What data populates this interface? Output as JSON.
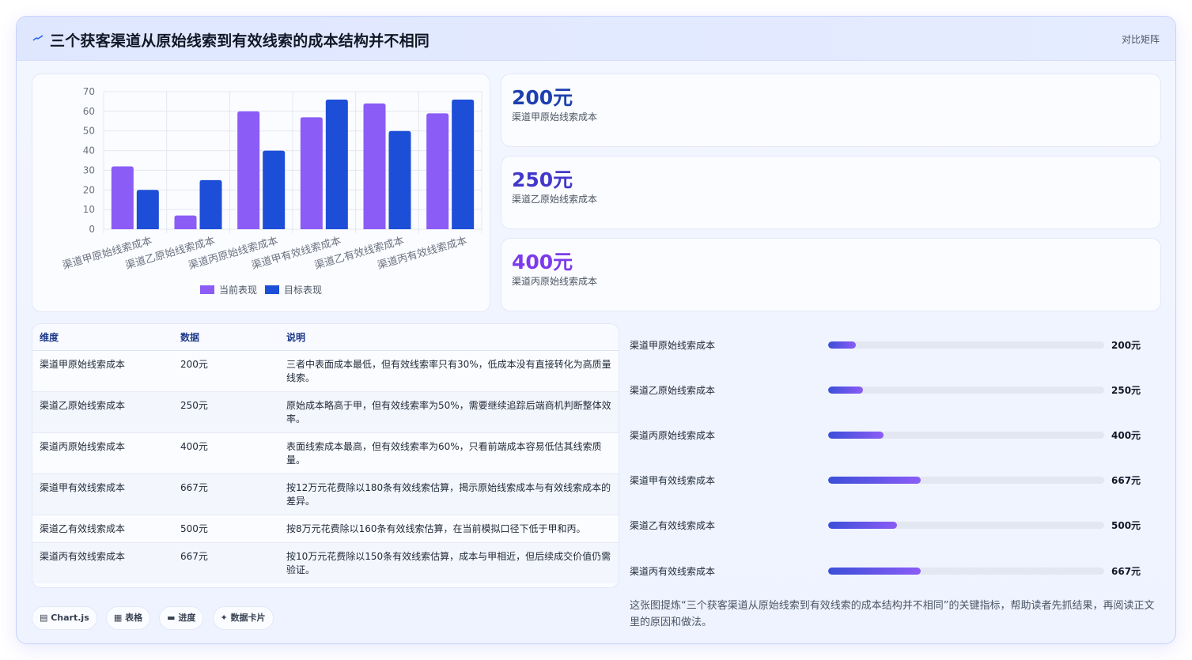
{
  "header": {
    "title": "三个获客渠道从原始线索到有效线索的成本结构并不相同",
    "link": "对比矩阵"
  },
  "chart_data": {
    "type": "bar",
    "categories": [
      "渠道甲原始线索成本",
      "渠道乙原始线索成本",
      "渠道丙原始线索成本",
      "渠道甲有效线索成本",
      "渠道乙有效线索成本",
      "渠道丙有效线索成本"
    ],
    "series": [
      {
        "name": "当前表现",
        "values": [
          32,
          7,
          60,
          57,
          64,
          59
        ],
        "color": "#8b5cf6"
      },
      {
        "name": "目标表现",
        "values": [
          20,
          25,
          40,
          66,
          50,
          66
        ],
        "color": "#1d4ed8"
      }
    ],
    "y_ticks": [
      "0",
      "10",
      "20",
      "30",
      "40",
      "50",
      "60",
      "70"
    ],
    "ylim": [
      0,
      70
    ],
    "grid": true,
    "legend_position": "bottom"
  },
  "kpis": [
    {
      "value": "200元",
      "label": "渠道甲原始线索成本",
      "color": "#1e40af"
    },
    {
      "value": "250元",
      "label": "渠道乙原始线索成本",
      "color": "#4338ca"
    },
    {
      "value": "400元",
      "label": "渠道丙原始线索成本",
      "color": "#7c3aed"
    }
  ],
  "table": {
    "headers": [
      "维度",
      "数据",
      "说明"
    ],
    "rows": [
      [
        "渠道甲原始线索成本",
        "200元",
        "三者中表面成本最低，但有效线索率只有30%，低成本没有直接转化为高质量线索。"
      ],
      [
        "渠道乙原始线索成本",
        "250元",
        "原始成本略高于甲，但有效线索率为50%，需要继续追踪后端商机判断整体效率。"
      ],
      [
        "渠道丙原始线索成本",
        "400元",
        "表面线索成本最高，但有效线索率为60%，只看前端成本容易低估其线索质量。"
      ],
      [
        "渠道甲有效线索成本",
        "667元",
        "按12万元花费除以180条有效线索估算，揭示原始线索成本与有效线索成本的差异。"
      ],
      [
        "渠道乙有效线索成本",
        "500元",
        "按8万元花费除以160条有效线索估算，在当前模拟口径下低于甲和丙。"
      ],
      [
        "渠道丙有效线索成本",
        "667元",
        "按10万元花费除以150条有效线索估算，成本与甲相近，但后续成交价值仍需验证。"
      ]
    ]
  },
  "progress": [
    {
      "label": "渠道甲原始线索成本",
      "value": "200元",
      "fraction": 0.1
    },
    {
      "label": "渠道乙原始线索成本",
      "value": "250元",
      "fraction": 0.125
    },
    {
      "label": "渠道丙原始线索成本",
      "value": "400元",
      "fraction": 0.2
    },
    {
      "label": "渠道甲有效线索成本",
      "value": "667元",
      "fraction": 0.335
    },
    {
      "label": "渠道乙有效线索成本",
      "value": "500元",
      "fraction": 0.25
    },
    {
      "label": "渠道丙有效线索成本",
      "value": "667元",
      "fraction": 0.335
    }
  ],
  "note": "这张图提炼“三个获客渠道从原始线索到有效线索的成本结构并不相同”的关键指标，帮助读者先抓结果，再阅读正文里的原因和做法。",
  "chips": [
    {
      "icon": "chart-icon",
      "label": "Chart.js"
    },
    {
      "icon": "table-icon",
      "label": "表格"
    },
    {
      "icon": "progress-icon",
      "label": "进度"
    },
    {
      "icon": "sparkle-icon",
      "label": "数据卡片"
    }
  ]
}
